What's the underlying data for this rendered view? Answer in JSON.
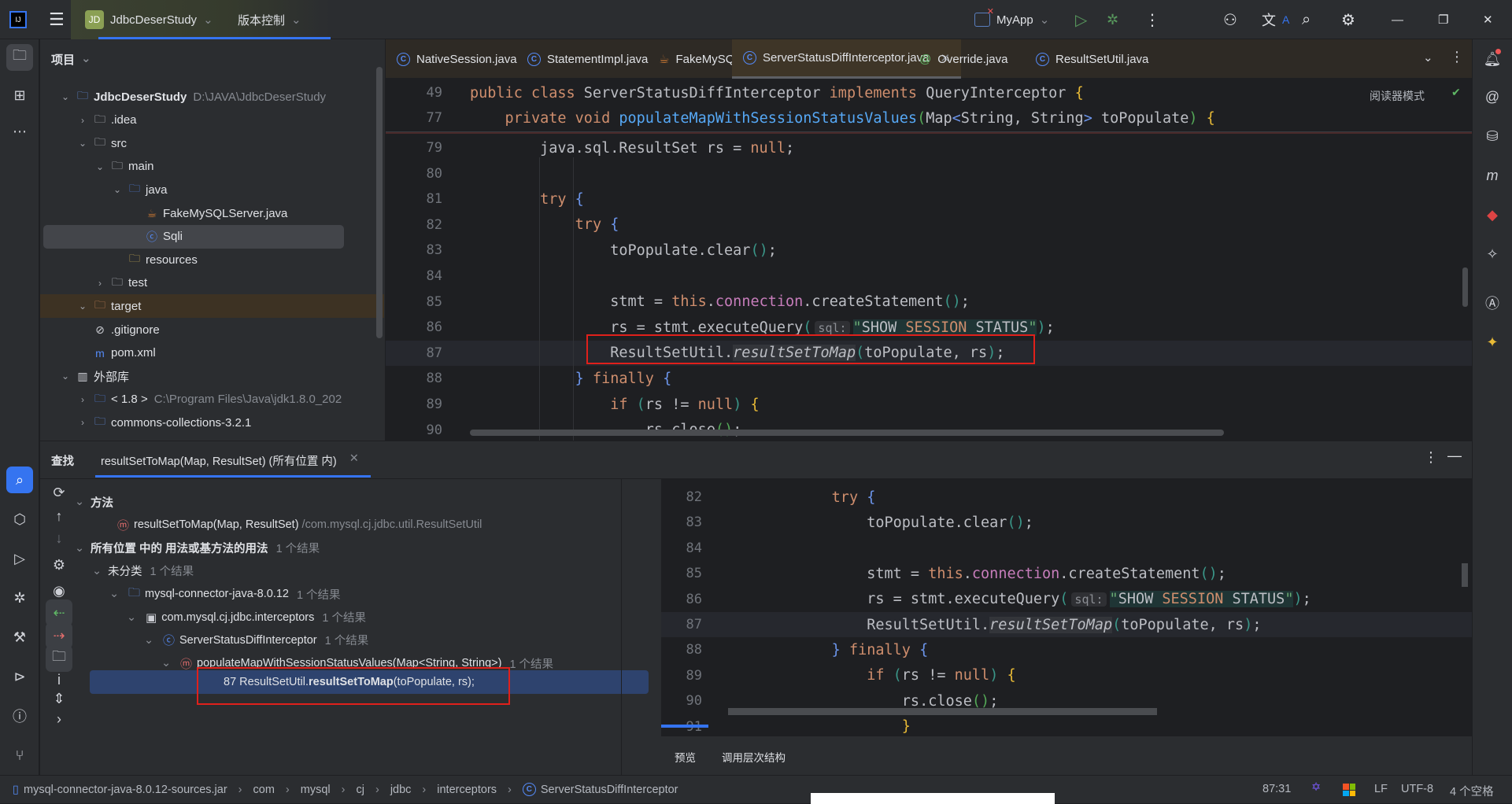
{
  "titlebar": {
    "project_badge": "JD",
    "project_name": "JdbcDeserStudy",
    "vcs": "版本控制",
    "run_config": "MyApp",
    "icons": [
      "app-logo-icon",
      "hamburger-menu-icon",
      "run-icon",
      "debug-icon",
      "more-icon",
      "add-user-icon",
      "translate-icon",
      "search-icon",
      "settings-icon",
      "minimize-icon",
      "restore-icon",
      "close-icon"
    ]
  },
  "project": {
    "header": "项目",
    "tree": [
      {
        "label": "JdbcDeserStudy",
        "hint": "D:\\JAVA\\JdbcDeserStudy",
        "depth": 0,
        "chev": "down",
        "icon": "module-folder-icon",
        "bold": true
      },
      {
        "label": ".idea",
        "depth": 1,
        "chev": "right",
        "icon": "folder-icon"
      },
      {
        "label": "src",
        "depth": 1,
        "chev": "down",
        "icon": "folder-icon"
      },
      {
        "label": "main",
        "depth": 2,
        "chev": "down",
        "icon": "folder-icon"
      },
      {
        "label": "java",
        "depth": 3,
        "chev": "down",
        "icon": "source-folder-icon"
      },
      {
        "label": "FakeMySQLServer.java",
        "depth": 4,
        "chev": "",
        "icon": "java-file-icon"
      },
      {
        "label": "Sqli",
        "depth": 4,
        "chev": "",
        "icon": "class-run-icon",
        "selected": true
      },
      {
        "label": "resources",
        "depth": 3,
        "chev": "",
        "icon": "resources-folder-icon"
      },
      {
        "label": "test",
        "depth": 2,
        "chev": "right",
        "icon": "folder-icon"
      },
      {
        "label": "target",
        "depth": 1,
        "chev": "down",
        "icon": "excluded-folder-icon",
        "excluded": true
      },
      {
        "label": ".gitignore",
        "depth": 1,
        "chev": "",
        "icon": "ignore-file-icon"
      },
      {
        "label": "pom.xml",
        "depth": 1,
        "chev": "",
        "icon": "maven-icon"
      },
      {
        "label": "外部库",
        "depth": 0,
        "chev": "down",
        "icon": "library-icon"
      },
      {
        "label": "< 1.8 >",
        "hint": "C:\\Program Files\\Java\\jdk1.8.0_202",
        "depth": 1,
        "chev": "right",
        "icon": "jdk-icon"
      },
      {
        "label": "commons-collections-3.2.1",
        "depth": 1,
        "chev": "right",
        "icon": "library-jar-icon"
      }
    ]
  },
  "tabs": [
    {
      "label": "NativeSession.java",
      "icon": "class-icon"
    },
    {
      "label": "StatementImpl.java",
      "icon": "class-icon"
    },
    {
      "label": "FakeMySQLServer.java",
      "icon": "java-file-icon"
    },
    {
      "label": "ServerStatusDiffInterceptor.java",
      "icon": "class-icon",
      "active": true
    },
    {
      "label": "Override.java",
      "icon": "annotation-icon"
    },
    {
      "label": "ResultSetUtil.java",
      "icon": "class-icon"
    }
  ],
  "editor": {
    "reader_mode": "阅读器模式",
    "sticky": [
      {
        "n": "49",
        "indent": 0,
        "t": [
          [
            "public ",
            "kw"
          ],
          [
            "class ",
            "kw"
          ],
          [
            "ServerStatusDiffInterceptor ",
            ""
          ],
          [
            "implements ",
            "kw"
          ],
          [
            "QueryInterceptor ",
            ""
          ],
          [
            "{",
            "b1"
          ]
        ]
      },
      {
        "n": "77",
        "indent": 4,
        "t": [
          [
            "private ",
            "kw"
          ],
          [
            "void ",
            "kw"
          ],
          [
            "populateMapWithSessionStatusValues",
            "fn"
          ],
          [
            "(",
            "b2"
          ],
          [
            "Map",
            ""
          ],
          [
            "<",
            "b3"
          ],
          [
            "String, String",
            ""
          ],
          [
            ">",
            "b3"
          ],
          [
            " toPopulate",
            ""
          ],
          [
            ")",
            "b2"
          ],
          [
            " ",
            ""
          ],
          [
            "{",
            "b1"
          ]
        ]
      }
    ],
    "lines": [
      {
        "n": "79",
        "indent": 8,
        "t": [
          [
            "java.sql.ResultSet rs = ",
            ""
          ],
          [
            "null",
            "kw"
          ],
          [
            ";",
            ""
          ]
        ]
      },
      {
        "n": "80",
        "indent": 0,
        "t": []
      },
      {
        "n": "81",
        "indent": 8,
        "t": [
          [
            "try ",
            "kw"
          ],
          [
            "{",
            "b3"
          ]
        ]
      },
      {
        "n": "82",
        "indent": 12,
        "t": [
          [
            "try ",
            "kw"
          ],
          [
            "{",
            "b3"
          ]
        ]
      },
      {
        "n": "83",
        "indent": 16,
        "t": [
          [
            "toPopulate.clear",
            ""
          ],
          [
            "()",
            "b4"
          ],
          [
            ";",
            ""
          ]
        ]
      },
      {
        "n": "84",
        "indent": 0,
        "t": []
      },
      {
        "n": "85",
        "indent": 16,
        "t": [
          [
            "stmt = ",
            ""
          ],
          [
            "this",
            "kw"
          ],
          [
            ".",
            ""
          ],
          [
            "connection",
            "fld"
          ],
          [
            ".createStatement",
            ""
          ],
          [
            "()",
            "b4"
          ],
          [
            ";",
            ""
          ]
        ]
      },
      {
        "n": "86",
        "indent": 16,
        "t": [
          [
            "rs = stmt.executeQuery",
            ""
          ],
          [
            "(",
            "b4"
          ],
          [
            "sql:",
            "hint"
          ],
          [
            "\"",
            "str sqlbg"
          ],
          [
            "SHOW ",
            "sqlbg"
          ],
          [
            "SESSION",
            "sqlkw"
          ],
          [
            " STATUS",
            "sqlbg"
          ],
          [
            "\"",
            "str sqlbg"
          ],
          [
            ")",
            "b4"
          ],
          [
            ";",
            ""
          ]
        ]
      },
      {
        "n": "87",
        "indent": 16,
        "current": true,
        "t": [
          [
            "ResultSetUtil.",
            ""
          ],
          [
            "resultSetToMap",
            "it"
          ],
          [
            "(",
            "b4"
          ],
          [
            "toPopulate, rs",
            ""
          ],
          [
            ")",
            "b4"
          ],
          [
            ";",
            ""
          ]
        ]
      },
      {
        "n": "88",
        "indent": 12,
        "t": [
          [
            "}",
            "b3"
          ],
          [
            " finally ",
            "kw"
          ],
          [
            "{",
            "b3"
          ]
        ]
      },
      {
        "n": "89",
        "indent": 16,
        "t": [
          [
            "if ",
            "kw"
          ],
          [
            "(",
            "b4"
          ],
          [
            "rs != ",
            ""
          ],
          [
            "null",
            "kw"
          ],
          [
            ")",
            "b4"
          ],
          [
            " ",
            ""
          ],
          [
            "{",
            "b1"
          ]
        ]
      },
      {
        "n": "90",
        "indent": 20,
        "t": [
          [
            "rs.close",
            ""
          ],
          [
            "()",
            "b2"
          ],
          [
            ";",
            ""
          ]
        ]
      }
    ]
  },
  "find": {
    "title": "查找",
    "tab_label": "resultSetToMap(Map, ResultSet) (所有位置 内)",
    "rows": [
      {
        "depth": 0,
        "chev": "down",
        "label": "方法",
        "bold": true
      },
      {
        "depth": 1,
        "icon": "method-icon",
        "label": "resultSetToMap(Map, ResultSet)",
        "hint": "/com.mysql.cj.jdbc.util.ResultSetUtil"
      },
      {
        "depth": 0,
        "chev": "down",
        "label": "所有位置 中的 用法或基方法的用法",
        "count": "1 个结果",
        "bold": true
      },
      {
        "depth": 1,
        "chev": "down",
        "label": "未分类",
        "count": "1 个结果"
      },
      {
        "depth": 2,
        "chev": "down",
        "icon": "library-jar-icon",
        "label": "mysql-connector-java-8.0.12",
        "count": "1 个结果"
      },
      {
        "depth": 3,
        "chev": "down",
        "icon": "package-icon",
        "label": "com.mysql.cj.jdbc.interceptors",
        "count": "1 个结果"
      },
      {
        "depth": 4,
        "chev": "down",
        "icon": "class-icon",
        "label": "ServerStatusDiffInterceptor",
        "count": "1 个结果"
      },
      {
        "depth": 5,
        "chev": "down",
        "icon": "method-icon",
        "label": "populateMapWithSessionStatusValues(Map<String, String>)",
        "count": "1 个结果"
      }
    ],
    "result": {
      "line": "87",
      "pre": "ResultSetUtil.",
      "match": "resultSetToMap",
      "post": "(toPopulate, rs);"
    },
    "preview_tabs": [
      "预览",
      "调用层次结构"
    ]
  },
  "preview": {
    "lines": [
      {
        "n": "82",
        "indent": 12,
        "t": [
          [
            "try ",
            "kw"
          ],
          [
            "{",
            "b3"
          ]
        ]
      },
      {
        "n": "83",
        "indent": 16,
        "t": [
          [
            "toPopulate.clear",
            ""
          ],
          [
            "()",
            "b4"
          ],
          [
            ";",
            ""
          ]
        ]
      },
      {
        "n": "84",
        "indent": 0,
        "t": []
      },
      {
        "n": "85",
        "indent": 16,
        "t": [
          [
            "stmt = ",
            ""
          ],
          [
            "this",
            "kw"
          ],
          [
            ".",
            ""
          ],
          [
            "connection",
            "fld"
          ],
          [
            ".createStatement",
            ""
          ],
          [
            "()",
            "b4"
          ],
          [
            ";",
            ""
          ]
        ]
      },
      {
        "n": "86",
        "indent": 16,
        "t": [
          [
            "rs = stmt.executeQuery",
            ""
          ],
          [
            "(",
            "b4"
          ],
          [
            "sql:",
            "hint"
          ],
          [
            "\"",
            "str sqlbg"
          ],
          [
            "SHOW ",
            "sqlbg"
          ],
          [
            "SESSION",
            "sqlkw"
          ],
          [
            " STATUS",
            "sqlbg"
          ],
          [
            "\"",
            "str sqlbg"
          ],
          [
            ")",
            "b4"
          ],
          [
            ";",
            ""
          ]
        ]
      },
      {
        "n": "87",
        "indent": 16,
        "current": true,
        "t": [
          [
            "ResultSetUtil.",
            ""
          ],
          [
            "resultSetToMap",
            "it"
          ],
          [
            "(",
            "b4"
          ],
          [
            "toPopulate, rs",
            ""
          ],
          [
            ")",
            "b4"
          ],
          [
            ";",
            ""
          ]
        ]
      },
      {
        "n": "88",
        "indent": 12,
        "t": [
          [
            "}",
            "b3"
          ],
          [
            " finally ",
            "kw"
          ],
          [
            "{",
            "b3"
          ]
        ]
      },
      {
        "n": "89",
        "indent": 16,
        "t": [
          [
            "if ",
            "kw"
          ],
          [
            "(",
            "b4"
          ],
          [
            "rs != ",
            ""
          ],
          [
            "null",
            "kw"
          ],
          [
            ")",
            "b4"
          ],
          [
            " ",
            ""
          ],
          [
            "{",
            "b1"
          ]
        ]
      },
      {
        "n": "90",
        "indent": 20,
        "t": [
          [
            "rs.close",
            ""
          ],
          [
            "()",
            "b2"
          ],
          [
            ";",
            ""
          ]
        ]
      },
      {
        "n": "91",
        "indent": 20,
        "t": [
          [
            "}",
            "b1"
          ]
        ]
      }
    ]
  },
  "status": {
    "crumbs": [
      "mysql-connector-java-8.0.12-sources.jar",
      "com",
      "mysql",
      "cj",
      "jdbc",
      "interceptors",
      "ServerStatusDiffInterceptor"
    ],
    "position": "87:31",
    "line_sep": "LF",
    "encoding": "UTF-8",
    "indent": "4 个空格"
  },
  "colors": {
    "accent": "#3574f0",
    "highlight_box": "#e0201b",
    "selection": "#2e436e"
  }
}
